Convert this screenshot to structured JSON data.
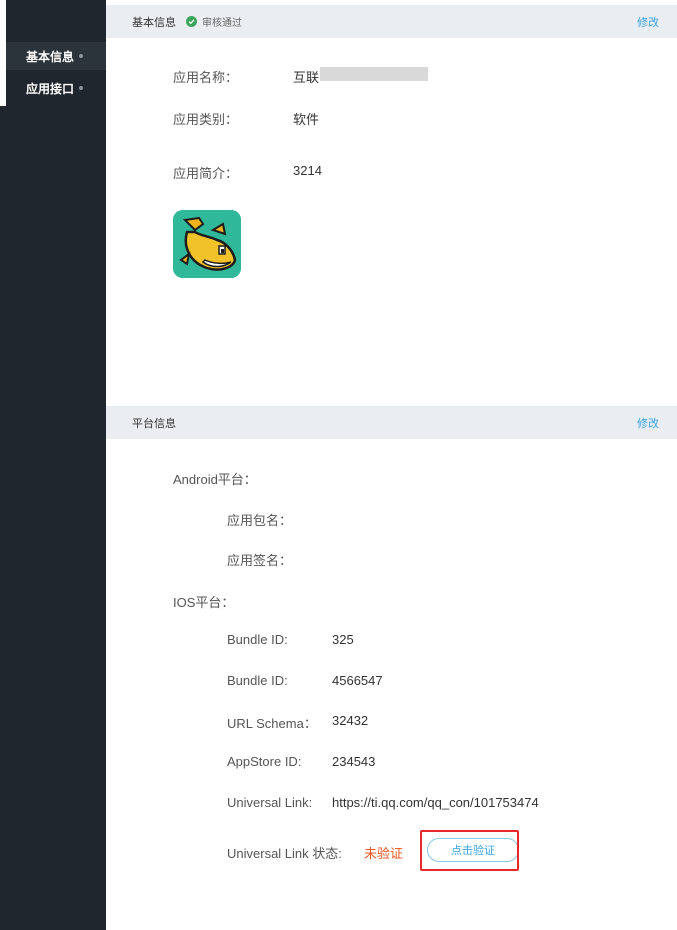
{
  "sidebar": {
    "items": [
      {
        "label": "基本信息"
      },
      {
        "label": "应用接口"
      }
    ]
  },
  "basic": {
    "title": "基本信息",
    "status": "审核通过",
    "edit": "修改",
    "fields": [
      {
        "label": "应用名称：",
        "value": "互联"
      },
      {
        "label": "应用类别：",
        "value": "软件"
      },
      {
        "label": "应用简介：",
        "value": "3214"
      }
    ]
  },
  "platform": {
    "title": "平台信息",
    "edit": "修改",
    "android_label": "Android平台：",
    "package_label": "应用包名：",
    "signature_label": "应用签名：",
    "ios_label": "IOS平台：",
    "ios_fields": [
      {
        "label": "Bundle ID:",
        "value": "325"
      },
      {
        "label": "Bundle ID:",
        "value": "4566547"
      },
      {
        "label": "URL Schema：",
        "value": "32432"
      },
      {
        "label": "AppStore ID:",
        "value": "234543"
      },
      {
        "label": "Universal Link:",
        "value": "https://ti.qq.com/qq_con/101753474"
      }
    ],
    "ul_status_label": "Universal Link 状态:",
    "ul_status_value": "未验证",
    "verify_button": "点击验证"
  },
  "colors": {
    "sidebar_bg": "#1f262d",
    "header_bg": "#eaedf1",
    "link": "#3aa3e3",
    "warning": "#e8541e",
    "highlight": "#e8292c",
    "success": "#3ba55c"
  }
}
